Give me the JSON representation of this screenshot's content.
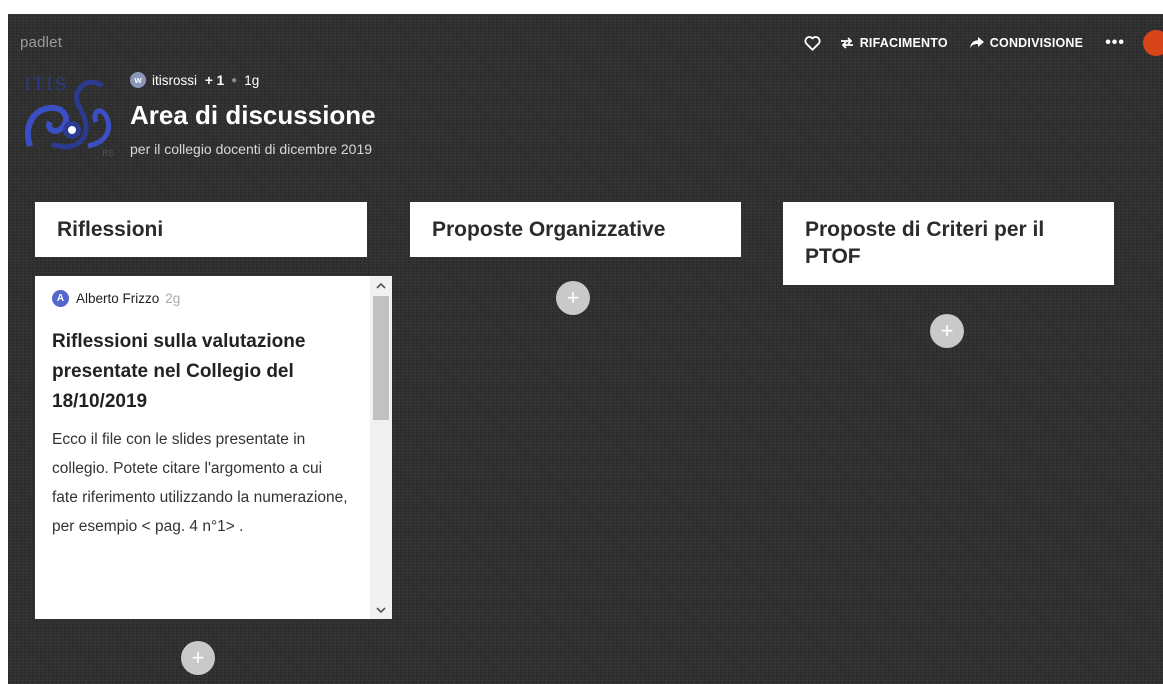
{
  "app": {
    "brand": "padlet"
  },
  "toolbar": {
    "remake_label": "RIFACIMENTO",
    "share_label": "CONDIVISIONE",
    "more_label": "•••"
  },
  "board": {
    "owner": "itisrossi",
    "owner_initial": "w",
    "contributors": "+ 1",
    "age": "1g",
    "title": "Area di discussione",
    "subtitle": "per il collegio docenti di dicembre 2019"
  },
  "columns": [
    {
      "title": "Riflessioni",
      "posts": [
        {
          "author": "Alberto Frizzo",
          "author_initial": "A",
          "time": "2g",
          "title": "Riflessioni sulla valutazione presentate nel Collegio del 18/10/2019",
          "body": "Ecco il file con le slides presentate in collegio. Potete citare l'argomento a cui fate riferimento utilizzando la numerazione, per esempio < pag. 4 n°1> ."
        }
      ]
    },
    {
      "title": "Proposte Organizzative",
      "posts": []
    },
    {
      "title": "Proposte di Criteri per il PTOF",
      "posts": []
    }
  ],
  "add_label": "+",
  "colors": {
    "background": "#2f2f2f",
    "accent_avatar": "#d9451b",
    "card": "#ffffff",
    "add_button": "#c9c9c9"
  },
  "icons": [
    "heart-icon",
    "remake-icon",
    "share-icon",
    "more-icon",
    "school-logo"
  ]
}
